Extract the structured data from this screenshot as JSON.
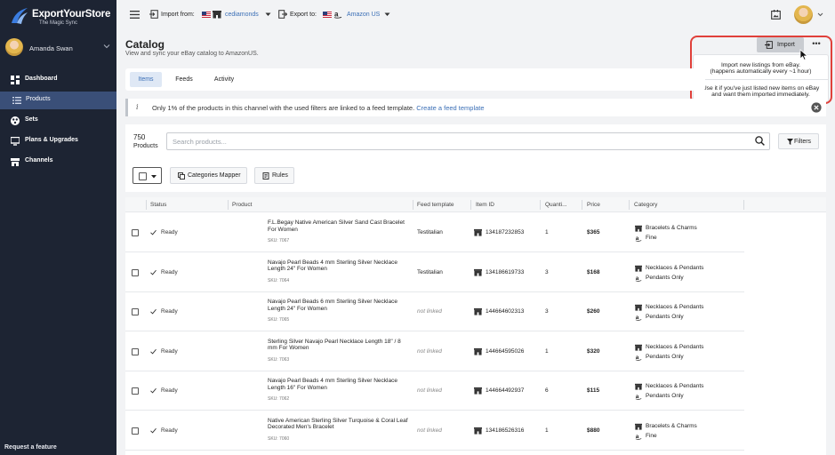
{
  "app": {
    "logo_title": "ExportYourStore",
    "logo_subtitle": "The Magic Sync"
  },
  "user": {
    "name": "Amanda Swan"
  },
  "sidebar": {
    "items": [
      {
        "label": "Dashboard",
        "icon": "dashboard-icon"
      },
      {
        "label": "Products",
        "icon": "list-icon",
        "active": true
      },
      {
        "label": "Sets",
        "icon": "sets-icon"
      },
      {
        "label": "Plans & Upgrades",
        "icon": "monitor-icon"
      },
      {
        "label": "Channels",
        "icon": "store-icon"
      }
    ],
    "request_feature": "Request a feature"
  },
  "topbar": {
    "import_from_label": "Import from:",
    "import_from_store": "cediamonds",
    "export_to_label": "Export to:",
    "export_to_store": "Amazon US"
  },
  "header": {
    "title": "Catalog",
    "subtitle": "View and sync your eBay catalog to AmazonUS.",
    "import_button": "Import",
    "more_button": "•••"
  },
  "tooltip": {
    "line1": "Import new listings from eBay.",
    "line2": "(happens automatically every ~1 hour)",
    "line3": "Use it if you've just listed new items on eBay",
    "line4": "and want them imported immediately."
  },
  "tabs": [
    {
      "label": "Items",
      "active": true
    },
    {
      "label": "Feeds"
    },
    {
      "label": "Activity"
    }
  ],
  "banner": {
    "icon": "i",
    "text": "Only 1% of the products in this channel with the used filters are linked to a feed template.",
    "link": "Create a feed template"
  },
  "products": {
    "count": "750",
    "count_label": "Products",
    "search_placeholder": "Search products...",
    "filters_label": "Filters",
    "categories_mapper_label": "Categories Mapper",
    "rules_label": "Rules"
  },
  "table": {
    "columns": [
      "Status",
      "Product",
      "Feed template",
      "Item ID",
      "Quanti...",
      "Price",
      "Category"
    ],
    "rows": [
      {
        "status": "Ready",
        "name": "F.L.Begay Native American Silver Sand Cast Bracelet For Women",
        "sku": "SKU: 7067",
        "feed": "Testitalian",
        "item_id": "134187232853",
        "qty": "1",
        "price": "$365",
        "cat1": "Bracelets & Charms",
        "cat2": "Fine"
      },
      {
        "status": "Ready",
        "name": "Navajo Pearl Beads 4 mm Sterling Silver Necklace Length 24\" For Women",
        "sku": "SKU: 7064",
        "feed": "Testitalian",
        "item_id": "134186619733",
        "qty": "3",
        "price": "$168",
        "cat1": "Necklaces & Pendants",
        "cat2": "Pendants Only"
      },
      {
        "status": "Ready",
        "name": "Navajo Pearl Beads 6 mm Sterling Silver Necklace Length 24\" For Women",
        "sku": "SKU: 7065",
        "feed": "not linked",
        "item_id": "144664602313",
        "qty": "3",
        "price": "$260",
        "cat1": "Necklaces & Pendants",
        "cat2": "Pendants Only"
      },
      {
        "status": "Ready",
        "name": "Sterling Silver Navajo Pearl Necklace Length 18\" / 8 mm For Women",
        "sku": "SKU: 7063",
        "feed": "not linked",
        "item_id": "144664595026",
        "qty": "1",
        "price": "$320",
        "cat1": "Necklaces & Pendants",
        "cat2": "Pendants Only"
      },
      {
        "status": "Ready",
        "name": "Navajo Pearl Beads 4 mm Sterling Silver Necklace Length 16\" For Women",
        "sku": "SKU: 7062",
        "feed": "not linked",
        "item_id": "144664492937",
        "qty": "6",
        "price": "$115",
        "cat1": "Necklaces & Pendants",
        "cat2": "Pendants Only"
      },
      {
        "status": "Ready",
        "name": "Native American Sterling Silver Turquoise & Coral Leaf Decorated Men's Bracelet",
        "sku": "SKU: 7060",
        "feed": "not linked",
        "item_id": "134186526316",
        "qty": "1",
        "price": "$880",
        "cat1": "Bracelets & Charms",
        "cat2": "Fine"
      }
    ]
  },
  "colors": {
    "sidebar_bg": "#1d2433",
    "sidebar_active": "#3a4f78",
    "accent": "#3b6fb6",
    "highlight_ring": "#e0403a"
  }
}
